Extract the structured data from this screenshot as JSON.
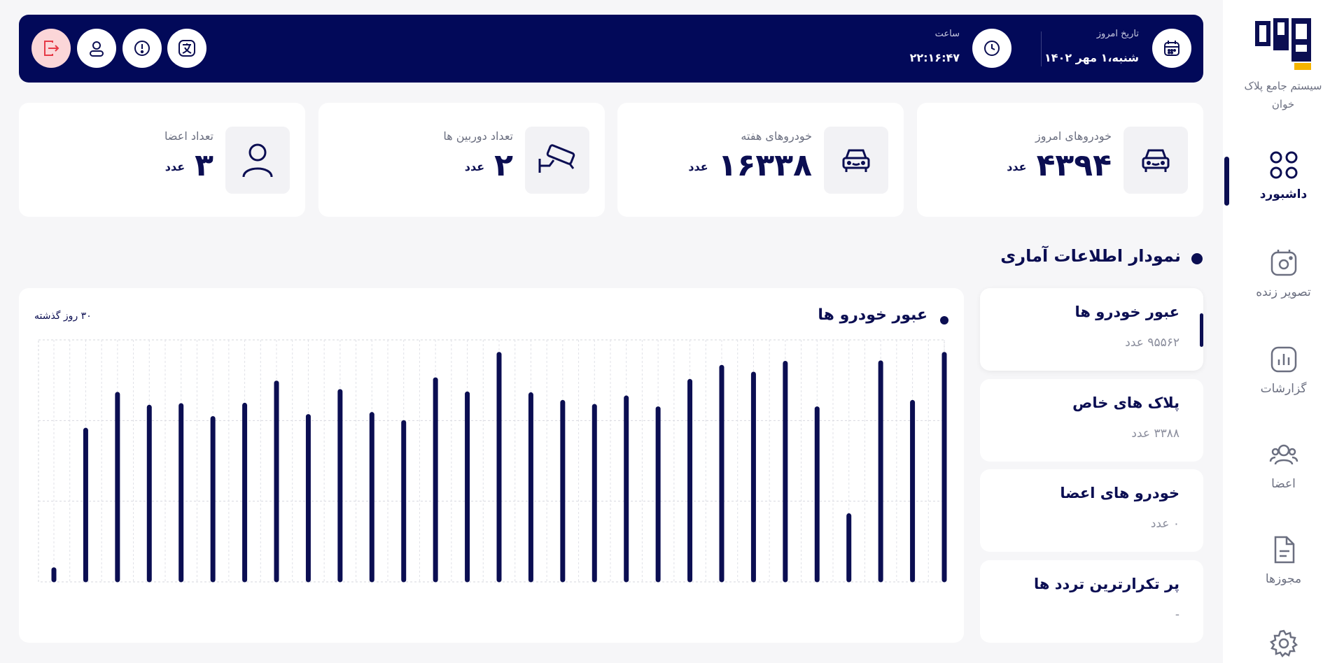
{
  "sidebar": {
    "brand_name": "سیستم جامع پلاک خوان",
    "items": [
      {
        "label": "داشبورد",
        "icon": "dashboard-grid-icon",
        "active": true
      },
      {
        "label": "تصویر زنده",
        "icon": "camera-icon",
        "active": false
      },
      {
        "label": "گزارشات",
        "icon": "chart-icon",
        "active": false
      },
      {
        "label": "اعضا",
        "icon": "users-icon",
        "active": false
      },
      {
        "label": "مجوزها",
        "icon": "document-icon",
        "active": false
      },
      {
        "label": "",
        "icon": "gear-icon",
        "active": false
      }
    ]
  },
  "topbar": {
    "date_label": "تاریخ امروز",
    "date_value": "شنبه،۱ مهر ۱۴۰۲",
    "time_label": "ساعت",
    "time_value": "۲۲:۱۶:۴۷",
    "buttons": [
      "translate-icon",
      "info-icon",
      "user-icon",
      "logout-icon"
    ]
  },
  "stats": [
    {
      "label": "خودروهای امروز",
      "value": "۴۳۹۴",
      "unit": "عدد",
      "icon": "car-icon"
    },
    {
      "label": "خودروهای هفته",
      "value": "۱۶۳۳۸",
      "unit": "عدد",
      "icon": "car-icon"
    },
    {
      "label": "تعداد دوربین ها",
      "value": "۲",
      "unit": "عدد",
      "icon": "cctv-camera-icon"
    },
    {
      "label": "تعداد اعضا",
      "value": "۳",
      "unit": "عدد",
      "icon": "person-icon"
    }
  ],
  "section": {
    "title": "نمودار اطلاعات آماری"
  },
  "chart_card": {
    "title": "عبور خودرو ها",
    "period": "۳۰ روز گذشته"
  },
  "filters": [
    {
      "title": "عبور خودرو ها",
      "sub": "۹۵۵۶۲ عدد",
      "active": true
    },
    {
      "title": "پلاک های خاص",
      "sub": "۳۳۸۸ عدد",
      "active": false
    },
    {
      "title": "خودرو های اعضا",
      "sub": "۰ عدد",
      "active": false
    },
    {
      "title": "پر تکرارترین تردد ها",
      "sub": "-",
      "active": false
    }
  ],
  "chart_data": {
    "type": "bar",
    "title": "عبور خودرو ها",
    "xlabel": "",
    "ylabel": "",
    "ylim": [
      0,
      6000
    ],
    "grid": true,
    "values": [
      300,
      3760,
      4650,
      4330,
      4370,
      4050,
      4380,
      4930,
      4100,
      4720,
      4150,
      3950,
      5010,
      4660,
      5640,
      4640,
      4450,
      4350,
      4560,
      4290,
      4970,
      5320,
      5150,
      5420,
      4290,
      1640,
      5430,
      4450,
      5640
    ]
  },
  "colors": {
    "primary": "#020959",
    "bar": "#0b0e52",
    "logout_bg": "#fbd6d8",
    "logout_icon": "#e63946",
    "card_bg": "#ffffff",
    "page_bg": "#f6f6f8"
  }
}
